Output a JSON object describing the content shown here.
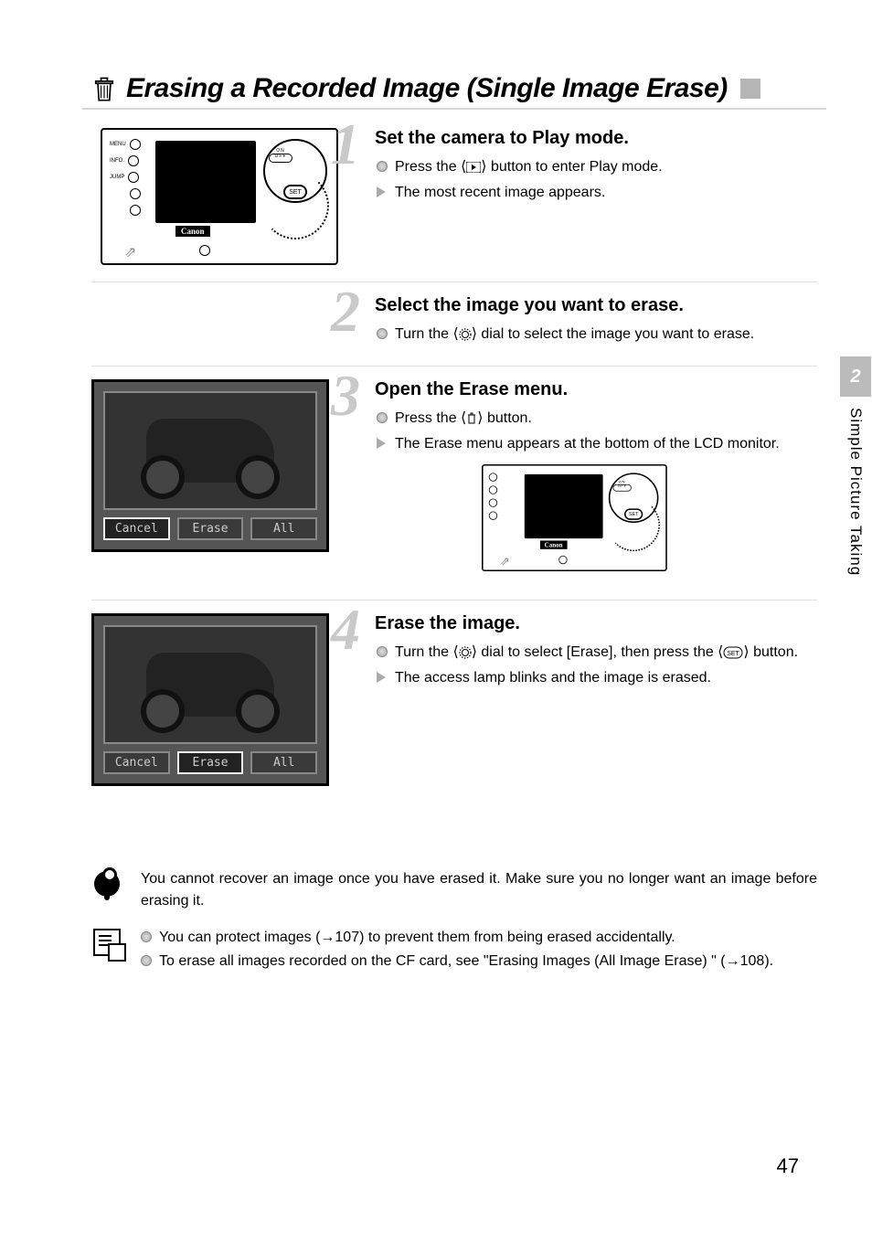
{
  "header": {
    "title": "Erasing a Recorded Image (Single Image Erase)"
  },
  "side_tab": {
    "chapter": "2",
    "label": "Simple Picture Taking"
  },
  "steps": [
    {
      "num": "1",
      "heading": "Set the camera to Play mode.",
      "bullets": [
        {
          "style": "circle",
          "pre": "Press the ⟨",
          "icon": "play",
          "post": "⟩ button to enter Play mode."
        },
        {
          "style": "arrow",
          "text": "The most recent image appears."
        }
      ]
    },
    {
      "num": "2",
      "heading": "Select the image you want to erase.",
      "bullets": [
        {
          "style": "circle",
          "pre": "Turn the ⟨",
          "icon": "dial",
          "post": "⟩ dial to select the image you want to erase."
        }
      ]
    },
    {
      "num": "3",
      "heading": "Open the Erase menu.",
      "bullets": [
        {
          "style": "circle",
          "pre": "Press the ⟨",
          "icon": "trash",
          "post": "⟩ button."
        },
        {
          "style": "arrow",
          "text": "The Erase menu appears at the bottom of the LCD monitor."
        }
      ]
    },
    {
      "num": "4",
      "heading": "Erase the image.",
      "bullets": [
        {
          "style": "circle",
          "pre": "Turn the ⟨",
          "icon": "dial",
          "mid": "⟩ dial to select [Erase], then press the ⟨",
          "icon2": "set",
          "post": "⟩ button."
        },
        {
          "style": "arrow",
          "text": "The access lamp blinks and the image is erased."
        }
      ]
    }
  ],
  "diagrams": {
    "camera": {
      "brand": "Canon",
      "labels": [
        "MENU",
        "INFO.",
        "JUMP"
      ],
      "set": "SET"
    },
    "lcd_step3": {
      "buttons": [
        "Cancel",
        "Erase",
        "All"
      ],
      "selected": 0
    },
    "lcd_step4": {
      "buttons": [
        "Cancel",
        "Erase",
        "All"
      ],
      "selected": 1
    }
  },
  "notes": {
    "warning": "You cannot recover an image once you have erased it. Make sure you no longer want an image before erasing it.",
    "tips": [
      "You can protect images (→107) to prevent them from being erased accidentally.",
      "To erase all images recorded on the CF card, see \"Erasing Images (All Image Erase) \" (→108)."
    ]
  },
  "page_number": "47"
}
